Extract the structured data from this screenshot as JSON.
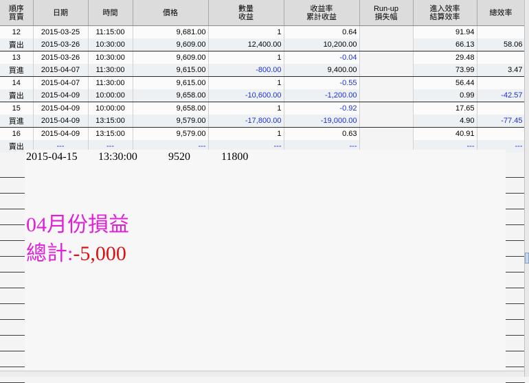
{
  "headers": [
    {
      "l1": "順序",
      "l2": "買賣"
    },
    {
      "l1": "日期",
      "l2": ""
    },
    {
      "l1": "時間",
      "l2": ""
    },
    {
      "l1": "價格",
      "l2": ""
    },
    {
      "l1": "數量",
      "l2": "收益"
    },
    {
      "l1": "收益率",
      "l2": "累計收益"
    },
    {
      "l1": "Run-up",
      "l2": "損失幅"
    },
    {
      "l1": "進入效率",
      "l2": "結算效率"
    },
    {
      "l1": "總效率",
      "l2": ""
    }
  ],
  "rows": [
    {
      "a": "12",
      "b": "2015-03-25",
      "c": "11:15:00",
      "d": "9,681.00",
      "e": "1",
      "f": "0.64",
      "g": "",
      "h": "91.94",
      "i": ""
    },
    {
      "a": "賣出",
      "b": "2015-03-26",
      "c": "10:30:00",
      "d": "9,609.00",
      "e": "12,400.00",
      "f": "10,200.00",
      "g": "",
      "h": "66.13",
      "i": "58.06"
    },
    {
      "a": "13",
      "b": "2015-03-26",
      "c": "10:30:00",
      "d": "9,609.00",
      "e": "1",
      "f": "-0.04",
      "g": "",
      "h": "29.48",
      "i": ""
    },
    {
      "a": "買進",
      "b": "2015-04-07",
      "c": "11:30:00",
      "d": "9,615.00",
      "e": "-800.00",
      "f": "9,400.00",
      "g": "",
      "h": "73.99",
      "i": "3.47"
    },
    {
      "a": "14",
      "b": "2015-04-07",
      "c": "11:30:00",
      "d": "9,615.00",
      "e": "1",
      "f": "-0.55",
      "g": "",
      "h": "56.44",
      "i": ""
    },
    {
      "a": "賣出",
      "b": "2015-04-09",
      "c": "10:00:00",
      "d": "9,658.00",
      "e": "-10,600.00",
      "f": "-1,200.00",
      "g": "",
      "h": "0.99",
      "i": "-42.57"
    },
    {
      "a": "15",
      "b": "2015-04-09",
      "c": "10:00:00",
      "d": "9,658.00",
      "e": "1",
      "f": "-0.92",
      "g": "",
      "h": "17.65",
      "i": ""
    },
    {
      "a": "買進",
      "b": "2015-04-09",
      "c": "13:15:00",
      "d": "9,579.00",
      "e": "-17,800.00",
      "f": "-19,000.00",
      "g": "",
      "h": "4.90",
      "i": "-77.45"
    },
    {
      "a": "16",
      "b": "2015-04-09",
      "c": "13:15:00",
      "d": "9,579.00",
      "e": "1",
      "f": "0.63",
      "g": "",
      "h": "40.91",
      "i": ""
    },
    {
      "a": "賣出",
      "b": "---",
      "c": "---",
      "d": "---",
      "e": "---",
      "f": "---",
      "g": "",
      "h": "---",
      "i": "---"
    }
  ],
  "overlay": {
    "date": "2015-04-15",
    "time": "13:30:00",
    "price": "9520",
    "amount": "11800",
    "month_title": "04月份損益",
    "total_label": "總計:",
    "total_value": "-5,000"
  },
  "colors": {
    "pink": "#e020d8",
    "red": "#e01010",
    "blue": "#1a2fd6"
  }
}
